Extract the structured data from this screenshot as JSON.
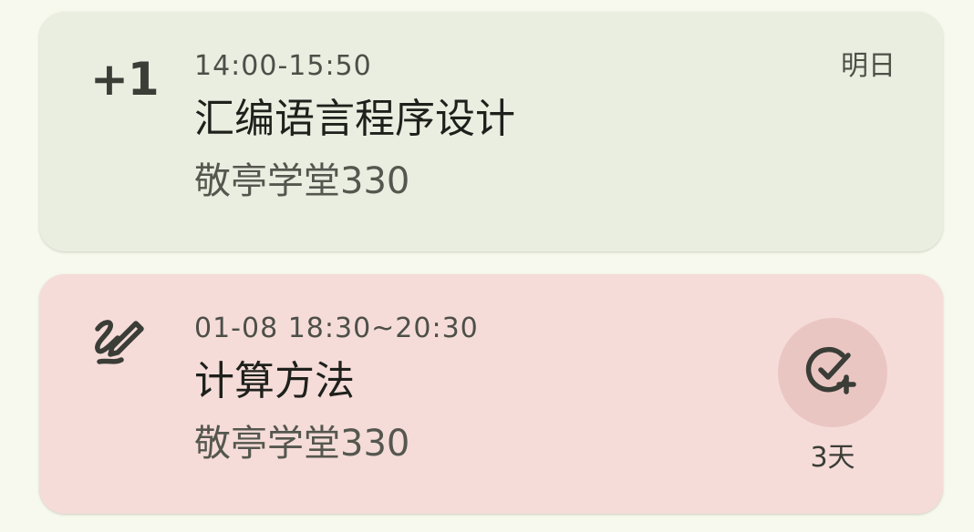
{
  "colors": {
    "background": "#f7f9ee",
    "class_card": "#eaeee1",
    "exam_card": "#f5dcd9",
    "exam_button": "#eac6c3"
  },
  "class_card": {
    "lead": "+1",
    "time": "14:00-15:50",
    "title": "汇编语言程序设计",
    "location": "敬亭学堂330",
    "day": "明日"
  },
  "exam_card": {
    "lead_icon": "pen-scribble-icon",
    "time": "01-08 18:30~20:30",
    "title": "计算方法",
    "location": "敬亭学堂330",
    "action_icon": "check-circle-plus-icon",
    "countdown": "3天"
  }
}
